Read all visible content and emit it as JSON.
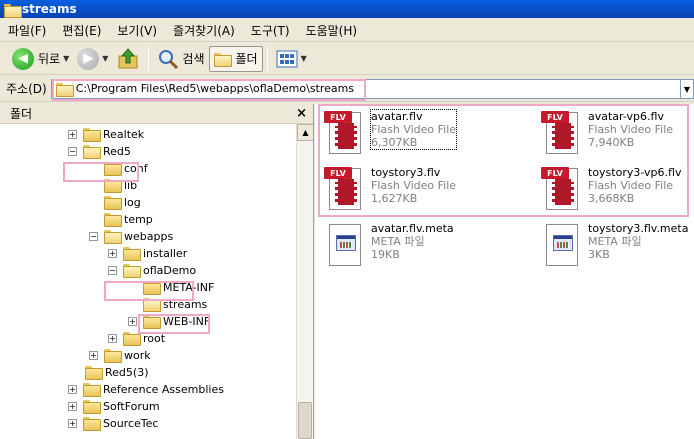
{
  "window": {
    "title": "streams"
  },
  "menu": [
    "파일(F)",
    "편집(E)",
    "보기(V)",
    "즐겨찾기(A)",
    "도구(T)",
    "도움말(H)"
  ],
  "toolbar": {
    "back_label": "뒤로",
    "search_label": "검색",
    "folders_label": "폴더"
  },
  "address": {
    "label": "주소(D)",
    "value": "C:\\Program Files\\Red5\\webapps\\oflaDemo\\streams"
  },
  "folder_pane": {
    "title": "폴더",
    "close": "×",
    "tree": [
      {
        "label": "Realtek",
        "expander": "+"
      },
      {
        "label": "Red5",
        "expander": "−"
      },
      {
        "label": "conf",
        "expander": ""
      },
      {
        "label": "lib",
        "expander": ""
      },
      {
        "label": "log",
        "expander": ""
      },
      {
        "label": "temp",
        "expander": ""
      },
      {
        "label": "webapps",
        "expander": "−"
      },
      {
        "label": "installer",
        "expander": "+"
      },
      {
        "label": "oflaDemo",
        "expander": "−"
      },
      {
        "label": "META-INF",
        "expander": ""
      },
      {
        "label": "streams",
        "expander": ""
      },
      {
        "label": "WEB-INF",
        "expander": "+"
      },
      {
        "label": "root",
        "expander": "+"
      },
      {
        "label": "work",
        "expander": "+"
      },
      {
        "label": "Red5(3)",
        "expander": ""
      },
      {
        "label": "Reference Assemblies",
        "expander": "+"
      },
      {
        "label": "SoftForum",
        "expander": "+"
      },
      {
        "label": "SourceTec",
        "expander": "+"
      }
    ]
  },
  "files": [
    {
      "name": "avatar.flv",
      "type": "Flash Video File",
      "size": "6,307KB",
      "icon": "flv-icon"
    },
    {
      "name": "avatar-vp6.flv",
      "type": "Flash Video File",
      "size": "7,940KB",
      "icon": "flv-icon"
    },
    {
      "name": "toystory3.flv",
      "type": "Flash Video File",
      "size": "1,627KB",
      "icon": "flv-icon"
    },
    {
      "name": "toystory3-vp6.flv",
      "type": "Flash Video File",
      "size": "3,668KB",
      "icon": "flv-icon"
    },
    {
      "name": "avatar.flv.meta",
      "type": "META 파일",
      "size": "19KB",
      "icon": "meta-file-icon"
    },
    {
      "name": "toystory3.flv.meta",
      "type": "META 파일",
      "size": "3KB",
      "icon": "meta-file-icon"
    }
  ],
  "flv_badge": "FLV",
  "colors": {
    "titlebar": "#0a5fe0",
    "highlight": "#f0a8c8",
    "flv_red": "#c41a2c"
  }
}
